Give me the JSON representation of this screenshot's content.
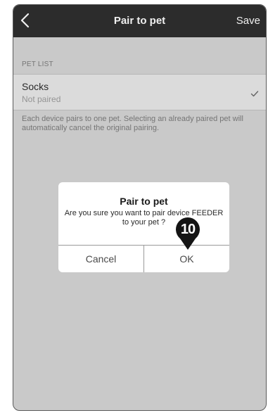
{
  "header": {
    "title": "Pair to pet",
    "save_label": "Save",
    "back_icon": "chevron-left-icon"
  },
  "pet_list": {
    "section_label": "PET LIST",
    "items": [
      {
        "name": "Socks",
        "status": "Not paired",
        "icon": "checkmark-icon"
      }
    ]
  },
  "hint": "Each device pairs to one pet. Selecting an already paired pet will automatically cancel the original pairing.",
  "dialog": {
    "title": "Pair to pet",
    "message": "Are you sure you want to pair device FEEDER to your pet ?",
    "cancel_label": "Cancel",
    "ok_label": "OK"
  },
  "callout": {
    "number": "10",
    "icon": "map-pin-icon"
  },
  "colors": {
    "header_bg": "#2f2f2f",
    "screen_bg": "#d6d6d6",
    "row_bg": "#e9e9e9",
    "dialog_bg": "#ffffff",
    "callout": "#141414"
  }
}
